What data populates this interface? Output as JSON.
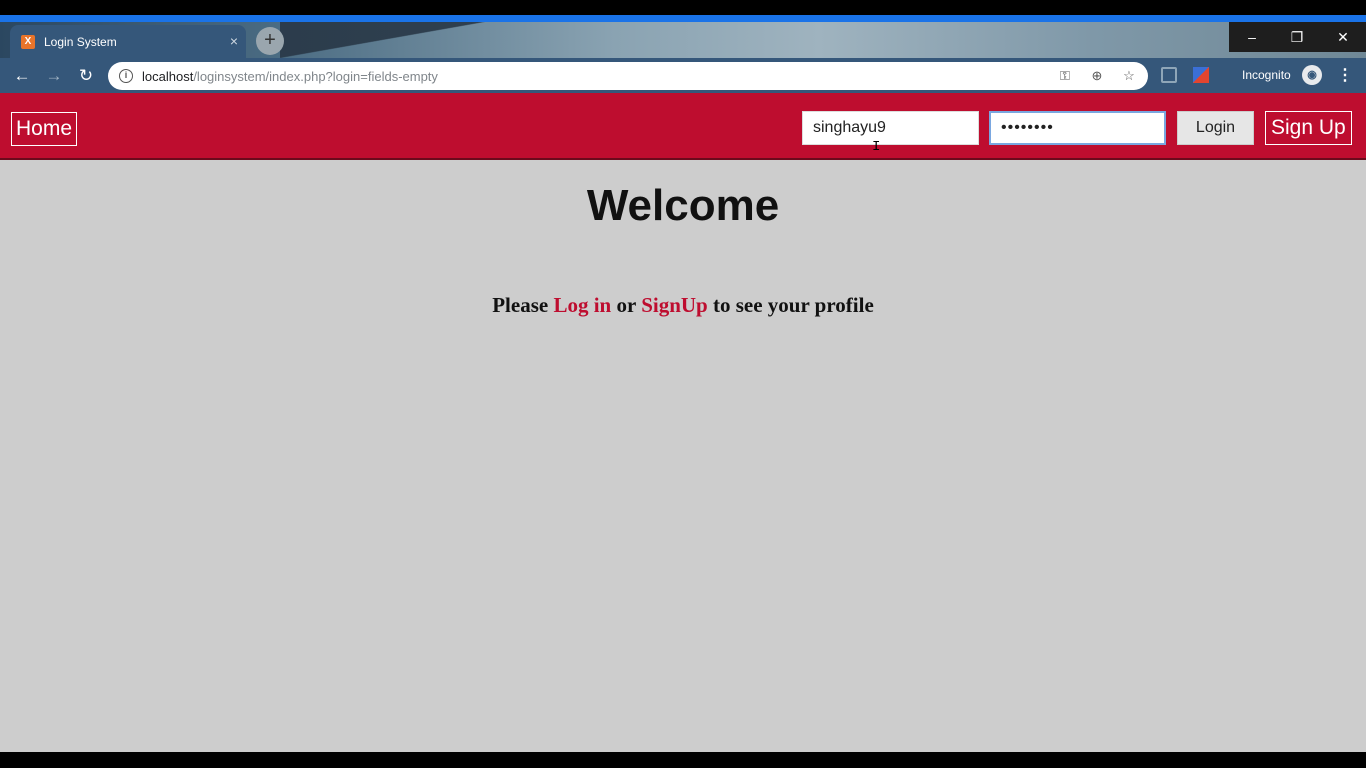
{
  "browser": {
    "tab": {
      "title": "Login System",
      "favicon": "xampp-icon",
      "close_label": "×"
    },
    "new_tab_label": "+",
    "window_controls": {
      "minimize": "–",
      "restore": "❐",
      "close": "✕"
    },
    "nav": {
      "back": "←",
      "forward": "→",
      "reload": "↻"
    },
    "address": {
      "host": "localhost",
      "path": "/loginsystem/index.php?login=fields-empty"
    },
    "omnibox_icons": [
      "key-icon",
      "zoom-icon",
      "star-icon"
    ],
    "omnibox_glyphs": {
      "key": "⚿",
      "zoom": "⊕",
      "star": "☆"
    },
    "incognito_label": "Incognito",
    "menu_label": "⋮"
  },
  "page": {
    "colors": {
      "brand": "#be0d2f",
      "background": "#cdcdcd"
    },
    "header": {
      "home_label": "Home",
      "username_value": "singhayu9",
      "password_value": "••••••••",
      "login_button": "Login",
      "signup_label": "Sign Up"
    },
    "welcome_title": "Welcome",
    "message": {
      "prefix": "Please",
      "login_link": "Log in",
      "middle": "or",
      "signup_link": "SignUp",
      "suffix": "to see your profile"
    }
  }
}
